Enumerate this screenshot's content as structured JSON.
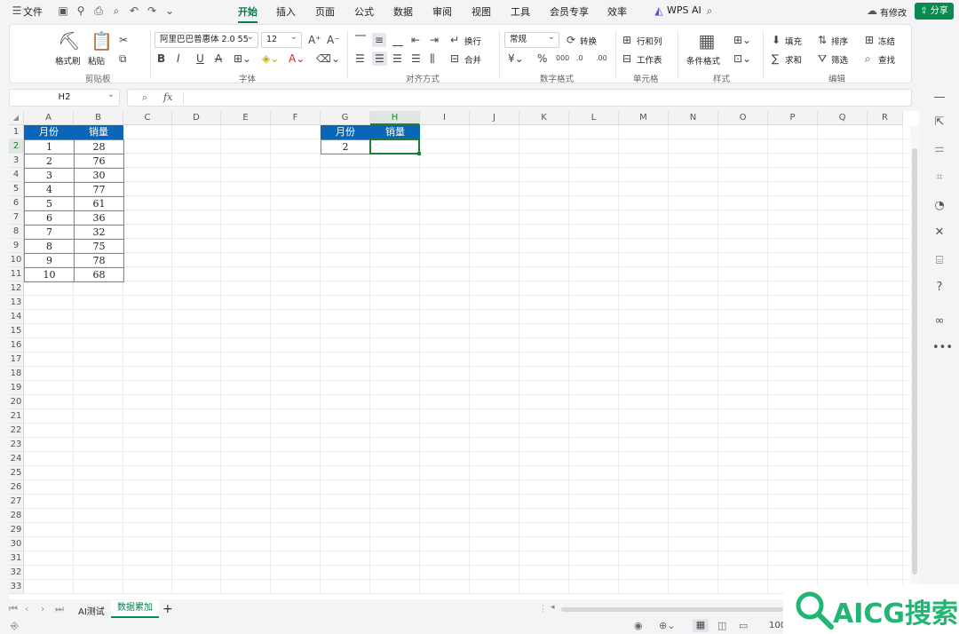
{
  "titlebar": {
    "file_label": "文件",
    "tabs": [
      "开始",
      "插入",
      "页面",
      "公式",
      "数据",
      "审阅",
      "视图",
      "工具",
      "会员专享",
      "效率"
    ],
    "ai_label": "WPS AI",
    "modified_label": "有修改",
    "share_label": "分享"
  },
  "ribbon": {
    "clipboard": {
      "format_painter": "格式刷",
      "paste": "粘贴",
      "group": "剪贴板"
    },
    "font": {
      "font_name": "阿里巴巴普惠体 2.0 55",
      "font_size": "12",
      "group": "字体"
    },
    "align": {
      "wrap": "换行",
      "merge": "合并",
      "group": "对齐方式"
    },
    "number": {
      "format": "常规",
      "convert": "转换",
      "group": "数字格式"
    },
    "cells": {
      "rows_cols": "行和列",
      "worksheet": "工作表",
      "group": "单元格"
    },
    "styles": {
      "conditional": "条件格式",
      "group": "样式"
    },
    "edit": {
      "fill": "填充",
      "sort": "排序",
      "freeze": "冻结",
      "sum": "求和",
      "filter": "筛选",
      "find": "查找",
      "group": "编辑"
    }
  },
  "formula": {
    "cell_ref": "H2",
    "fx": "fx",
    "value": ""
  },
  "columns": [
    "A",
    "B",
    "C",
    "D",
    "E",
    "F",
    "G",
    "H",
    "I",
    "J",
    "K",
    "L",
    "M",
    "N",
    "O",
    "P",
    "Q",
    "R"
  ],
  "rows": [
    "1",
    "2",
    "3",
    "4",
    "5",
    "6",
    "7",
    "8",
    "9",
    "10",
    "11",
    "12",
    "13",
    "14",
    "15",
    "16",
    "17",
    "18",
    "19",
    "20",
    "21",
    "22",
    "23",
    "24",
    "25",
    "26",
    "27",
    "28",
    "29",
    "30",
    "31",
    "32",
    "33"
  ],
  "table1": {
    "headers": [
      "月份",
      "销量"
    ],
    "data": [
      [
        "1",
        "28"
      ],
      [
        "2",
        "76"
      ],
      [
        "3",
        "30"
      ],
      [
        "4",
        "77"
      ],
      [
        "5",
        "61"
      ],
      [
        "6",
        "36"
      ],
      [
        "7",
        "32"
      ],
      [
        "8",
        "75"
      ],
      [
        "9",
        "78"
      ],
      [
        "10",
        "68"
      ]
    ]
  },
  "table2": {
    "headers": [
      "月份",
      "销量"
    ],
    "month": "2",
    "sales": ""
  },
  "sheets": {
    "tabs": [
      "AI测试",
      "数据累加"
    ],
    "active": "数据累加"
  },
  "status": {
    "zoom": "100"
  },
  "watermark": {
    "text": "AICG搜索"
  },
  "colors": {
    "accent": "#0a8a4f",
    "header_fill": "#0b66b8",
    "selection": "#1e7f3c"
  }
}
